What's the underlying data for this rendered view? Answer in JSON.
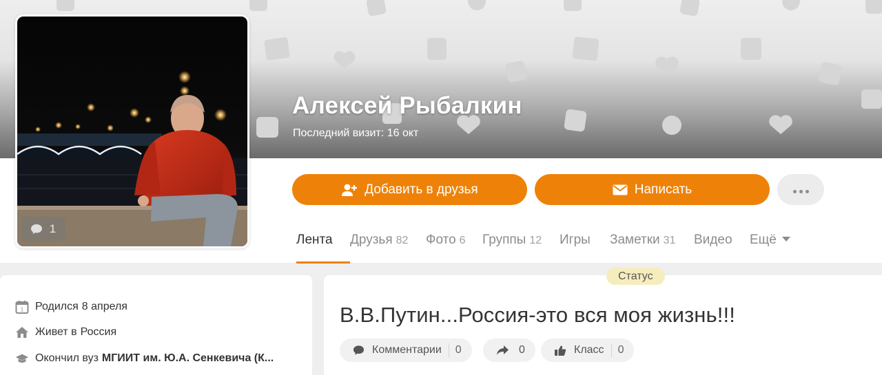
{
  "profile": {
    "name": "Алексей Рыбалкин",
    "last_visit": "Последний визит: 16 окт",
    "avatar_comments_count": "1"
  },
  "actions": {
    "add_friend": "Добавить в друзья",
    "write_message": "Написать"
  },
  "tabs": [
    {
      "label": "Лента",
      "count": "",
      "active": true
    },
    {
      "label": "Друзья",
      "count": "82"
    },
    {
      "label": "Фото",
      "count": "6"
    },
    {
      "label": "Группы",
      "count": "12"
    },
    {
      "label": "Игры",
      "count": ""
    },
    {
      "label": "Заметки",
      "count": "31"
    },
    {
      "label": "Видео",
      "count": ""
    },
    {
      "label": "Ещё",
      "count": ""
    }
  ],
  "info": {
    "born_prefix": "Родился",
    "born_value": "8 апреля",
    "lives_prefix": "Живет в",
    "lives_value": "Россия",
    "education_prefix": "Окончил вуз",
    "education_value": "МГИИТ им. Ю.А. Сенкевича (К..."
  },
  "status": {
    "badge": "Статус",
    "text": "В.В.Путин...Россия-это вся моя жизнь!!!",
    "comments_label": "Комментарии",
    "comments_count": "0",
    "shares_count": "0",
    "likes_label": "Класс",
    "likes_count": "0"
  },
  "colors": {
    "accent": "#ee8208",
    "badge_bg": "#f6edbd",
    "page_bg": "#efefef"
  }
}
